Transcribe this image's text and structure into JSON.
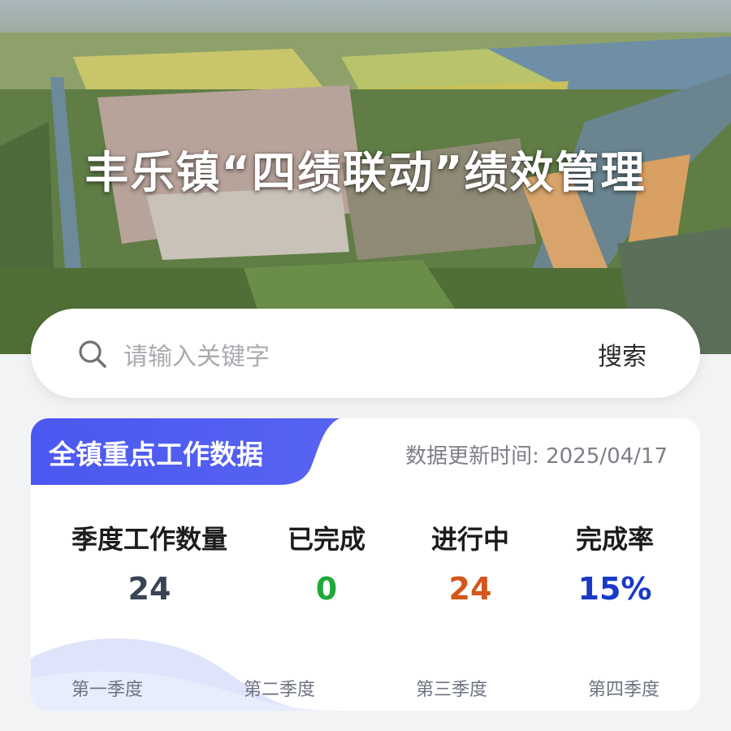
{
  "hero": {
    "title": "丰乐镇“四绩联动”绩效管理"
  },
  "search": {
    "placeholder": "请输入关键字",
    "button_label": "搜索",
    "icon": "search-icon"
  },
  "data_card": {
    "tag_label": "全镇重点工作数据",
    "update_label": "数据更新时间: ",
    "update_date": "2025/04/17",
    "stats": [
      {
        "label": "季度工作数量",
        "value": "24",
        "color": "#3a4455"
      },
      {
        "label": "已完成",
        "value": "0",
        "color": "#1fa83a"
      },
      {
        "label": "进行中",
        "value": "24",
        "color": "#d2571b"
      },
      {
        "label": "完成率",
        "value": "15%",
        "color": "#1a39c8"
      }
    ],
    "quarters": [
      "第一季度",
      "第二季度",
      "第三季度",
      "第四季度"
    ]
  },
  "colors": {
    "accent": "#4f5cf0",
    "page_bg": "#f2f3f5"
  }
}
